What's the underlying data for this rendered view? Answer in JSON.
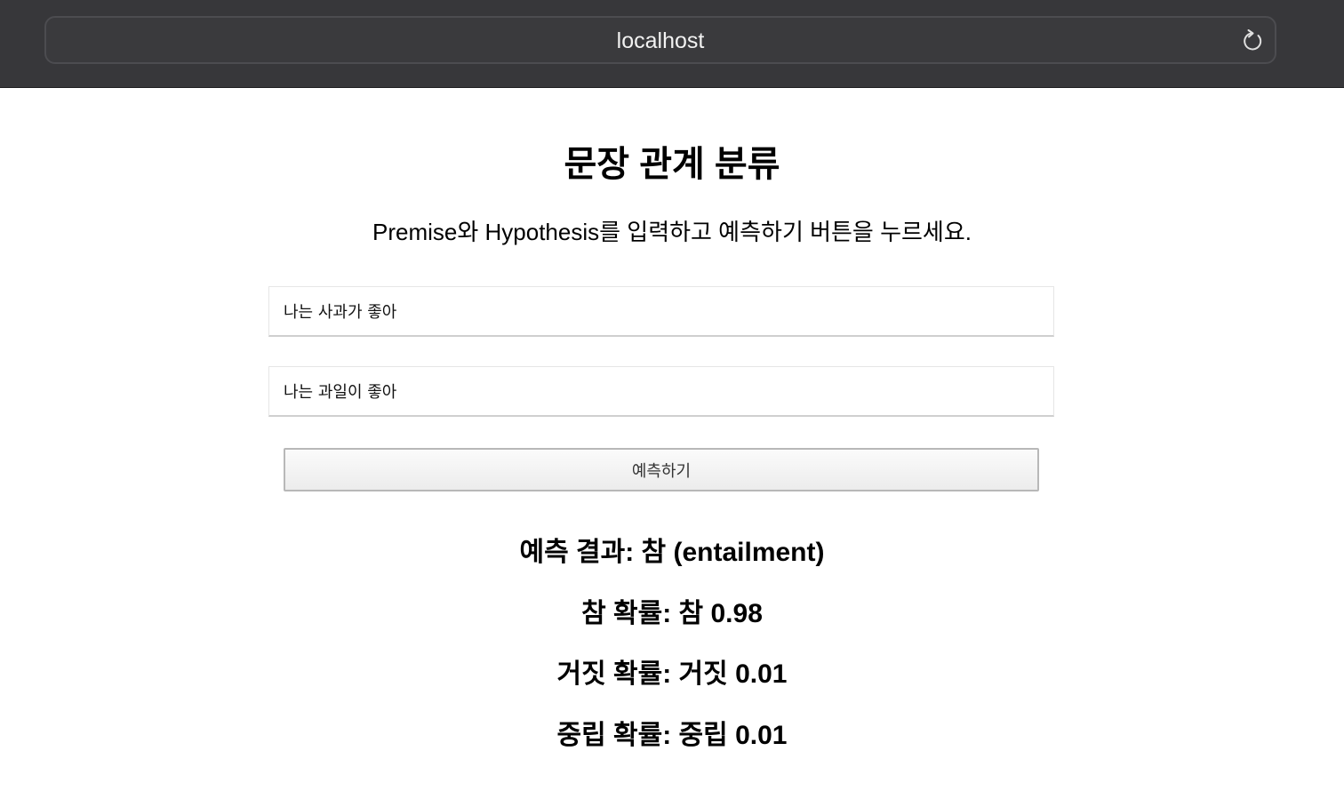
{
  "browser": {
    "url": "localhost"
  },
  "page": {
    "title": "문장 관계 분류",
    "instruction": "Premise와 Hypothesis를 입력하고 예측하기 버튼을 누르세요.",
    "premise_value": "나는 사과가 좋아",
    "hypothesis_value": "나는 과일이 좋아",
    "predict_label": "예측하기"
  },
  "results": {
    "prediction": "예측 결과: 참 (entailment)",
    "prob_true": "참 확률: 참 0.98",
    "prob_false": "거짓 확률: 거짓 0.01",
    "prob_neutral": "중립 확률: 중립 0.01"
  },
  "icons": {
    "reload": "reload-icon"
  },
  "colors": {
    "toolbar_bg": "#37373a",
    "page_bg": "#ffffff",
    "button_border": "#b8b8b8"
  }
}
